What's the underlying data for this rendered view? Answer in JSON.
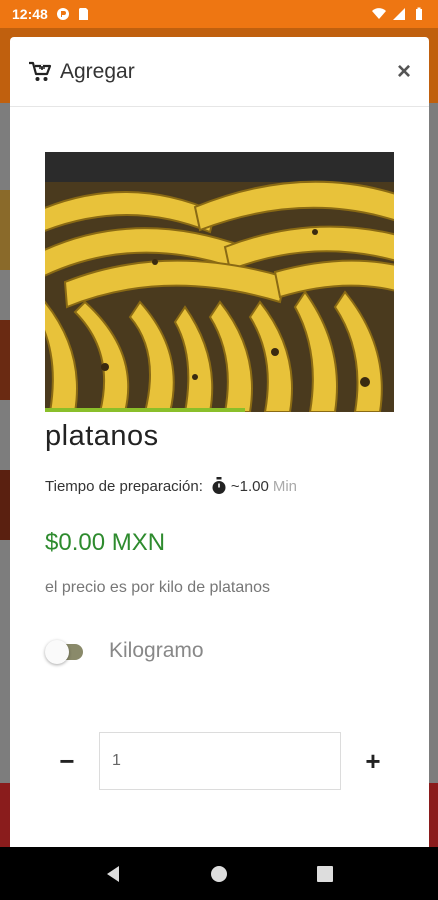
{
  "status_bar": {
    "time": "12:48",
    "icons_left": [
      "pocket-icon",
      "sd-card-icon"
    ],
    "icons_right": [
      "wifi-icon",
      "signal-icon",
      "battery-icon"
    ]
  },
  "modal": {
    "title": "Agregar",
    "title_icon": "cart-add-icon",
    "close_label": "×",
    "product": {
      "image_alt": "bananas",
      "name": "platanos",
      "prep_label": "Tiempo de preparación:",
      "prep_value": "~1.00",
      "prep_unit": "Min",
      "price": "$0.00 MXN",
      "description": "el precio es por kilo de platanos"
    },
    "toggle": {
      "label": "Kilogramo",
      "on": false
    },
    "quantity": {
      "minus_label": "−",
      "plus_label": "+",
      "value": "1"
    }
  },
  "colors": {
    "status_bar": "#ee7612",
    "price": "#2e8b2e"
  }
}
